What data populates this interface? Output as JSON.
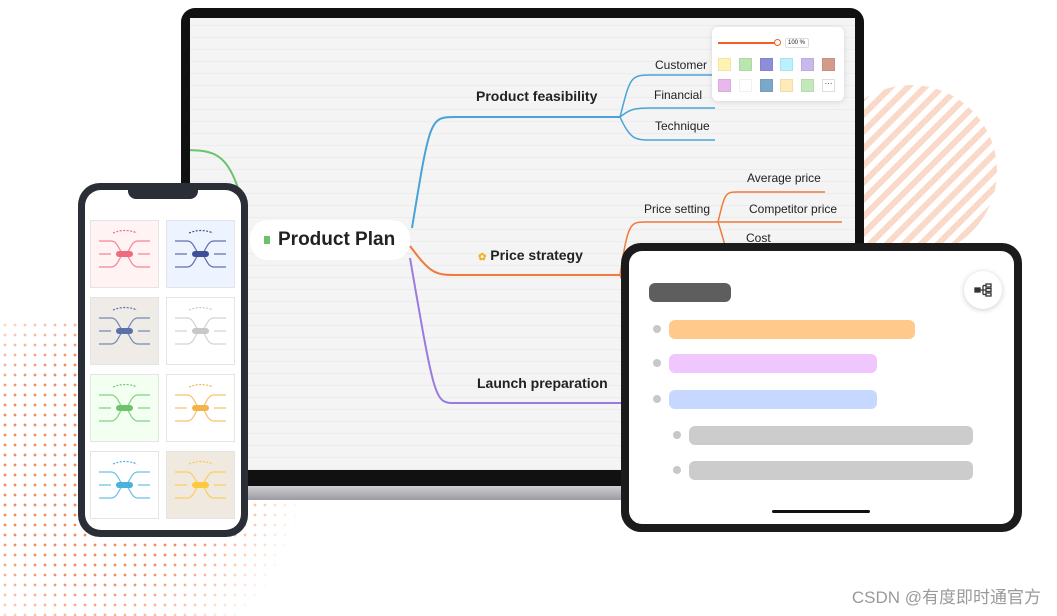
{
  "mindmap": {
    "root": "Product Plan",
    "branches": [
      {
        "label": "Product feasibility",
        "color": "#4aa3d8",
        "children": [
          "Customer",
          "Financial",
          "Technique"
        ]
      },
      {
        "label": "Price strategy",
        "color": "#f07a3c",
        "icon": "star-icon",
        "children": [
          {
            "label": "Price setting",
            "children": [
              "Average price",
              "Competitor price",
              "Cost"
            ]
          }
        ]
      },
      {
        "label": "Launch preparation",
        "color": "#9b7ae0",
        "children": []
      }
    ],
    "extra_branch_color": "#6cc36c"
  },
  "style_panel": {
    "zoom": "100 %",
    "slider_color": "#f0601e",
    "swatches": [
      "#fff2b3",
      "#b9e5b0",
      "#8c8ed8",
      "#b8f1ff",
      "#c8b8ec",
      "#d49a8a",
      "#e6b8ec",
      "#ffffff",
      "#7ba8c8",
      "#ffeab8",
      "#c4e8bc"
    ],
    "more": "···"
  },
  "phone": {
    "templates": [
      {
        "bg": "#fff3f3",
        "accent": "#f06a80"
      },
      {
        "bg": "#eef4ff",
        "accent": "#3d4f99"
      },
      {
        "bg": "#efebe6",
        "accent": "#5a70a8"
      },
      {
        "bg": "#ffffff",
        "accent": "#c8c8c8"
      },
      {
        "bg": "#f3fff0",
        "accent": "#6cc36c"
      },
      {
        "bg": "#ffffff",
        "accent": "#f2b44a"
      },
      {
        "bg": "#ffffff",
        "accent": "#4ab0dc"
      },
      {
        "bg": "#efe9df",
        "accent": "#ffc83d"
      }
    ]
  },
  "tablet": {
    "icon": "mindmap-view-icon",
    "bars": [
      "#5e5e5e",
      "#ffc98c",
      "#f0c6ff",
      "#c6d8ff",
      "#cccccc",
      "#cccccc"
    ]
  },
  "watermark": "CSDN @有度即时通官方"
}
